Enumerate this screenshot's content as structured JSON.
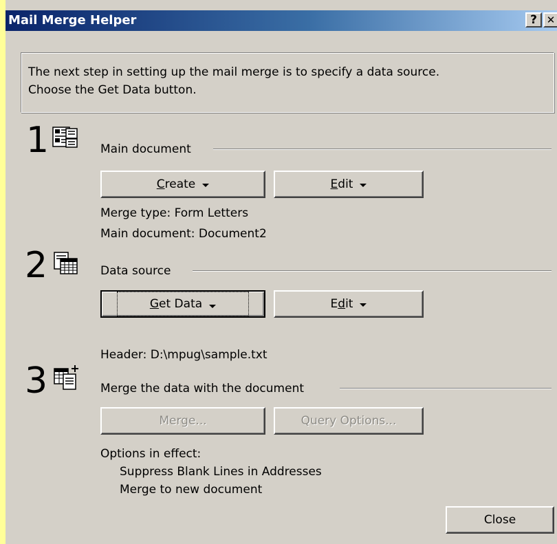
{
  "window": {
    "title": "Mail Merge Helper",
    "help_glyph": "?",
    "close_glyph": "✕"
  },
  "info": {
    "line1": "The next step in setting up the mail merge is to specify a data source.",
    "line2": "Choose the Get Data button."
  },
  "step1": {
    "number": "1",
    "icon": "main-document-icon",
    "label": "Main document",
    "create_label": "Create",
    "create_accel": "C",
    "edit_label": "Edit",
    "edit_accel": "E",
    "merge_type": "Merge type: Form Letters",
    "main_doc": "Main document: Document2"
  },
  "step2": {
    "number": "2",
    "icon": "data-source-icon",
    "label": "Data source",
    "get_data_label": "Get Data",
    "get_data_accel": "G",
    "edit_label": "Edit",
    "edit_accel": "d",
    "header": "Header: D:\\mpug\\sample.txt"
  },
  "step3": {
    "number": "3",
    "icon": "merge-icon",
    "label": "Merge the data with the document",
    "merge_label": "Merge...",
    "query_label": "Query Options...",
    "options_title": "Options in effect:",
    "option1": "Suppress Blank Lines in Addresses",
    "option2": "Merge to new document"
  },
  "footer": {
    "close_label": "Close"
  },
  "colors": {
    "dialog_bg": "#d4d0c8",
    "title_gradient_start": "#0a246a",
    "title_gradient_end": "#a6caf0",
    "outer_bg": "#ffff99",
    "disabled_text": "#8e8c86"
  }
}
